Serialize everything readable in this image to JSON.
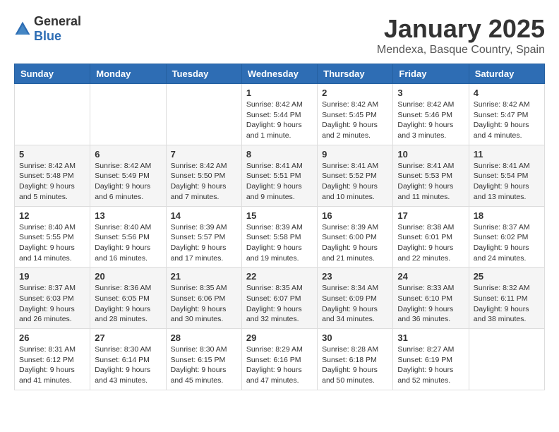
{
  "header": {
    "logo_general": "General",
    "logo_blue": "Blue",
    "title": "January 2025",
    "subtitle": "Mendexa, Basque Country, Spain"
  },
  "weekdays": [
    "Sunday",
    "Monday",
    "Tuesday",
    "Wednesday",
    "Thursday",
    "Friday",
    "Saturday"
  ],
  "weeks": [
    [
      {
        "day": "",
        "info": ""
      },
      {
        "day": "",
        "info": ""
      },
      {
        "day": "",
        "info": ""
      },
      {
        "day": "1",
        "info": "Sunrise: 8:42 AM\nSunset: 5:44 PM\nDaylight: 9 hours and 1 minute."
      },
      {
        "day": "2",
        "info": "Sunrise: 8:42 AM\nSunset: 5:45 PM\nDaylight: 9 hours and 2 minutes."
      },
      {
        "day": "3",
        "info": "Sunrise: 8:42 AM\nSunset: 5:46 PM\nDaylight: 9 hours and 3 minutes."
      },
      {
        "day": "4",
        "info": "Sunrise: 8:42 AM\nSunset: 5:47 PM\nDaylight: 9 hours and 4 minutes."
      }
    ],
    [
      {
        "day": "5",
        "info": "Sunrise: 8:42 AM\nSunset: 5:48 PM\nDaylight: 9 hours and 5 minutes."
      },
      {
        "day": "6",
        "info": "Sunrise: 8:42 AM\nSunset: 5:49 PM\nDaylight: 9 hours and 6 minutes."
      },
      {
        "day": "7",
        "info": "Sunrise: 8:42 AM\nSunset: 5:50 PM\nDaylight: 9 hours and 7 minutes."
      },
      {
        "day": "8",
        "info": "Sunrise: 8:41 AM\nSunset: 5:51 PM\nDaylight: 9 hours and 9 minutes."
      },
      {
        "day": "9",
        "info": "Sunrise: 8:41 AM\nSunset: 5:52 PM\nDaylight: 9 hours and 10 minutes."
      },
      {
        "day": "10",
        "info": "Sunrise: 8:41 AM\nSunset: 5:53 PM\nDaylight: 9 hours and 11 minutes."
      },
      {
        "day": "11",
        "info": "Sunrise: 8:41 AM\nSunset: 5:54 PM\nDaylight: 9 hours and 13 minutes."
      }
    ],
    [
      {
        "day": "12",
        "info": "Sunrise: 8:40 AM\nSunset: 5:55 PM\nDaylight: 9 hours and 14 minutes."
      },
      {
        "day": "13",
        "info": "Sunrise: 8:40 AM\nSunset: 5:56 PM\nDaylight: 9 hours and 16 minutes."
      },
      {
        "day": "14",
        "info": "Sunrise: 8:39 AM\nSunset: 5:57 PM\nDaylight: 9 hours and 17 minutes."
      },
      {
        "day": "15",
        "info": "Sunrise: 8:39 AM\nSunset: 5:58 PM\nDaylight: 9 hours and 19 minutes."
      },
      {
        "day": "16",
        "info": "Sunrise: 8:39 AM\nSunset: 6:00 PM\nDaylight: 9 hours and 21 minutes."
      },
      {
        "day": "17",
        "info": "Sunrise: 8:38 AM\nSunset: 6:01 PM\nDaylight: 9 hours and 22 minutes."
      },
      {
        "day": "18",
        "info": "Sunrise: 8:37 AM\nSunset: 6:02 PM\nDaylight: 9 hours and 24 minutes."
      }
    ],
    [
      {
        "day": "19",
        "info": "Sunrise: 8:37 AM\nSunset: 6:03 PM\nDaylight: 9 hours and 26 minutes."
      },
      {
        "day": "20",
        "info": "Sunrise: 8:36 AM\nSunset: 6:05 PM\nDaylight: 9 hours and 28 minutes."
      },
      {
        "day": "21",
        "info": "Sunrise: 8:35 AM\nSunset: 6:06 PM\nDaylight: 9 hours and 30 minutes."
      },
      {
        "day": "22",
        "info": "Sunrise: 8:35 AM\nSunset: 6:07 PM\nDaylight: 9 hours and 32 minutes."
      },
      {
        "day": "23",
        "info": "Sunrise: 8:34 AM\nSunset: 6:09 PM\nDaylight: 9 hours and 34 minutes."
      },
      {
        "day": "24",
        "info": "Sunrise: 8:33 AM\nSunset: 6:10 PM\nDaylight: 9 hours and 36 minutes."
      },
      {
        "day": "25",
        "info": "Sunrise: 8:32 AM\nSunset: 6:11 PM\nDaylight: 9 hours and 38 minutes."
      }
    ],
    [
      {
        "day": "26",
        "info": "Sunrise: 8:31 AM\nSunset: 6:12 PM\nDaylight: 9 hours and 41 minutes."
      },
      {
        "day": "27",
        "info": "Sunrise: 8:30 AM\nSunset: 6:14 PM\nDaylight: 9 hours and 43 minutes."
      },
      {
        "day": "28",
        "info": "Sunrise: 8:30 AM\nSunset: 6:15 PM\nDaylight: 9 hours and 45 minutes."
      },
      {
        "day": "29",
        "info": "Sunrise: 8:29 AM\nSunset: 6:16 PM\nDaylight: 9 hours and 47 minutes."
      },
      {
        "day": "30",
        "info": "Sunrise: 8:28 AM\nSunset: 6:18 PM\nDaylight: 9 hours and 50 minutes."
      },
      {
        "day": "31",
        "info": "Sunrise: 8:27 AM\nSunset: 6:19 PM\nDaylight: 9 hours and 52 minutes."
      },
      {
        "day": "",
        "info": ""
      }
    ]
  ]
}
